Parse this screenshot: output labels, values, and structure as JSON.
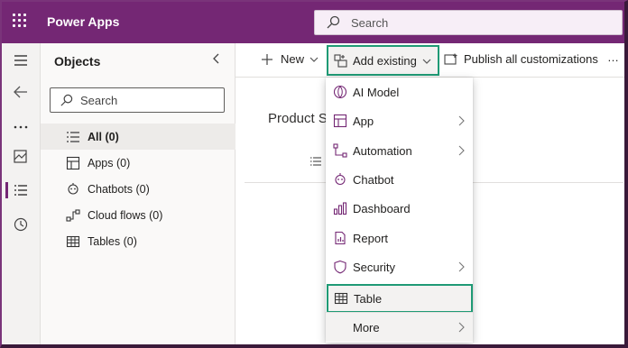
{
  "topbar": {
    "app_title": "Power Apps",
    "search_placeholder": "Search",
    "color": "#742774"
  },
  "objects": {
    "title": "Objects",
    "search_placeholder": "Search",
    "items": [
      {
        "label": "All",
        "count": "(0)",
        "icon": "list-icon",
        "selected": true
      },
      {
        "label": "Apps",
        "count": "(0)",
        "icon": "apps-icon"
      },
      {
        "label": "Chatbots",
        "count": "(0)",
        "icon": "chatbot-icon"
      },
      {
        "label": "Cloud flows",
        "count": "(0)",
        "icon": "flow-icon"
      },
      {
        "label": "Tables",
        "count": "(0)",
        "icon": "table-icon"
      }
    ]
  },
  "commandbar": {
    "new_label": "New",
    "add_existing_label": "Add existing",
    "publish_label": "Publish all customizations",
    "more_label": "…"
  },
  "main": {
    "product_title": "Product S"
  },
  "add_existing_menu": {
    "items": [
      {
        "label": "AI Model",
        "icon": "ai-model-icon",
        "submenu": false
      },
      {
        "label": "App",
        "icon": "app-icon",
        "submenu": true
      },
      {
        "label": "Automation",
        "icon": "automation-icon",
        "submenu": true
      },
      {
        "label": "Chatbot",
        "icon": "chatbot-icon",
        "submenu": false
      },
      {
        "label": "Dashboard",
        "icon": "dashboard-icon",
        "submenu": false
      },
      {
        "label": "Report",
        "icon": "report-icon",
        "submenu": false
      },
      {
        "label": "Security",
        "icon": "security-icon",
        "submenu": true
      },
      {
        "label": "Table",
        "icon": "table-icon",
        "submenu": false,
        "highlighted": true
      },
      {
        "label": "More",
        "icon": "",
        "submenu": true
      }
    ]
  },
  "highlight_color": "#1f9a75"
}
